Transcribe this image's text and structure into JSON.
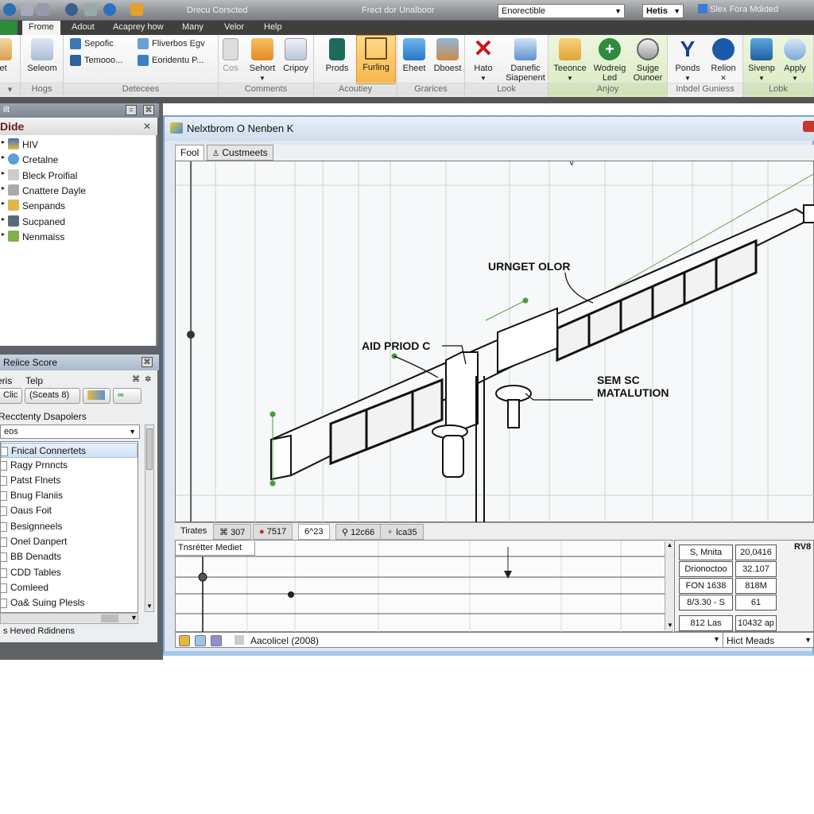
{
  "titlebar": {
    "document_title": "Drecu Corscted",
    "app_title": "Frect dor Unalboor",
    "search_combo_value": "Enorectible",
    "zoom_combo_value": "Hetis",
    "side_label": "Slex Fora Mdided"
  },
  "menu": {
    "tabs": [
      "Frome",
      "Adout",
      "Acaprey how",
      "Many",
      "Velor",
      "Help"
    ],
    "active_tab": "Frome"
  },
  "ribbon": {
    "groups": [
      {
        "label": "",
        "buttons": [
          {
            "label": "net",
            "icon": "notebook-icon"
          }
        ]
      },
      {
        "label": "Hogs",
        "buttons": [
          {
            "label": "Seleom",
            "icon": "clipboard-icon"
          }
        ]
      },
      {
        "label": "Detecees",
        "small_items": [
          {
            "label": "Sepofic",
            "icon": "gear-icon"
          },
          {
            "label": "Temooo...",
            "icon": "people-icon"
          },
          {
            "label": "Fliverbos Egv",
            "icon": "globe-icon"
          },
          {
            "label": "Eoridentu P...",
            "icon": "network-icon"
          }
        ]
      },
      {
        "label": "Comments",
        "buttons": [
          {
            "label": "Cos",
            "icon": "frame-icon"
          },
          {
            "label": "Sehort",
            "icon": "notepad-icon"
          },
          {
            "label": "Cripoy",
            "icon": "document-stack-icon"
          }
        ]
      },
      {
        "label": "Acoutiey",
        "buttons": [
          {
            "label": "Prods",
            "icon": "building-icon"
          },
          {
            "label": "Furling",
            "icon": "easel-icon",
            "highlighted": true
          }
        ]
      },
      {
        "label": "Grarices",
        "buttons": [
          {
            "label": "Eheet",
            "icon": "sheet-icon"
          },
          {
            "label": "Dboest",
            "icon": "chart-box-icon"
          }
        ]
      },
      {
        "label": "Look",
        "buttons": [
          {
            "label": "Hato",
            "icon": "red-x-icon"
          },
          {
            "label": "Danefic Siapenent",
            "icon": "monitor-chart-icon"
          }
        ]
      },
      {
        "label": "Anjoy",
        "green": true,
        "buttons": [
          {
            "label": "Teeonce",
            "icon": "hand-icon"
          },
          {
            "label": "Wodreig Led",
            "icon": "plus-circle-icon"
          },
          {
            "label": "Sujge Ounoer",
            "icon": "clock-icon"
          }
        ]
      },
      {
        "label": "Inbdel Guniess",
        "buttons": [
          {
            "label": "Ponds",
            "icon": "curve-icon"
          },
          {
            "label": "Relion",
            "icon": "blue-badge-icon"
          }
        ]
      },
      {
        "label": "Lobk",
        "green": true,
        "buttons": [
          {
            "label": "Sivenp",
            "icon": "image-icon"
          },
          {
            "label": "Apply",
            "icon": "sparkle-icon"
          }
        ]
      }
    ]
  },
  "panel1": {
    "header": "ilt",
    "title": "Dide",
    "items": [
      {
        "label": "HIV",
        "icon": "monitor-icon"
      },
      {
        "label": "Cretalne",
        "icon": "heart-shield-icon"
      },
      {
        "label": "Bleck Proifial",
        "icon": "tools-icon"
      },
      {
        "label": "Cnattere Dayle",
        "icon": "hand-tool-icon"
      },
      {
        "label": "Senpands",
        "icon": "envelope-icon"
      },
      {
        "label": "Sucpaned",
        "icon": "disk-icon"
      },
      {
        "label": "Nenmaiss",
        "icon": "map-icon"
      }
    ]
  },
  "panel2": {
    "title": "Reiice Score",
    "menu": [
      "eris",
      "Telp"
    ],
    "buttons": [
      "Clic",
      "(Sceats 8)"
    ],
    "section_label": "Recctenty Dsapolers",
    "dropdown_value": "eos",
    "items": [
      {
        "label": "Fnical Connertets",
        "selected": true
      },
      {
        "label": "Ragy Prnncts"
      },
      {
        "label": "Patst Flnets"
      },
      {
        "label": "Bnug Flaniis"
      },
      {
        "label": "Oaus Foit"
      },
      {
        "label": "Besignneels"
      },
      {
        "label": "Onel Danpert"
      },
      {
        "label": "BB Denadts"
      },
      {
        "label": "CDD Tables"
      },
      {
        "label": "Comleed"
      },
      {
        "label": "Oa& Suing Plesls"
      }
    ],
    "status": "s Heved Rdidnens"
  },
  "main_window": {
    "title": "Nelxtbrom O Nenben K",
    "canvas_tabs": [
      "Fool",
      "Custmeets"
    ],
    "active_canvas_tab": "Fool",
    "callouts": [
      "URNGET OLOR",
      "AID PRIOD C",
      "SEM SC",
      "MATALUTION"
    ],
    "lower_tabs": [
      {
        "label": "Tirates",
        "icon": ""
      },
      {
        "label": "307",
        "icon": "bracket-icon"
      },
      {
        "label": "7517",
        "icon": "red-dot-icon"
      },
      {
        "label": "6^23",
        "icon": ""
      },
      {
        "label": "12c66",
        "icon": "lock-icon"
      },
      {
        "label": "lca35",
        "icon": "pin-icon"
      }
    ],
    "active_lower_tab": "6^23",
    "timeline_label": "Tnsrétter Mediet",
    "properties": [
      [
        "S, Mnita",
        "20,0416"
      ],
      [
        "Drionoctoo",
        "32.107"
      ],
      [
        "FON 1638",
        "818M"
      ],
      [
        "8/3.30 - S",
        "61"
      ]
    ],
    "properties_footer": [
      "812 Las",
      "10432 ap"
    ],
    "properties_header": "RV8",
    "status_text": "Aacolicel (2008)",
    "status_right": "Hict Meads"
  }
}
